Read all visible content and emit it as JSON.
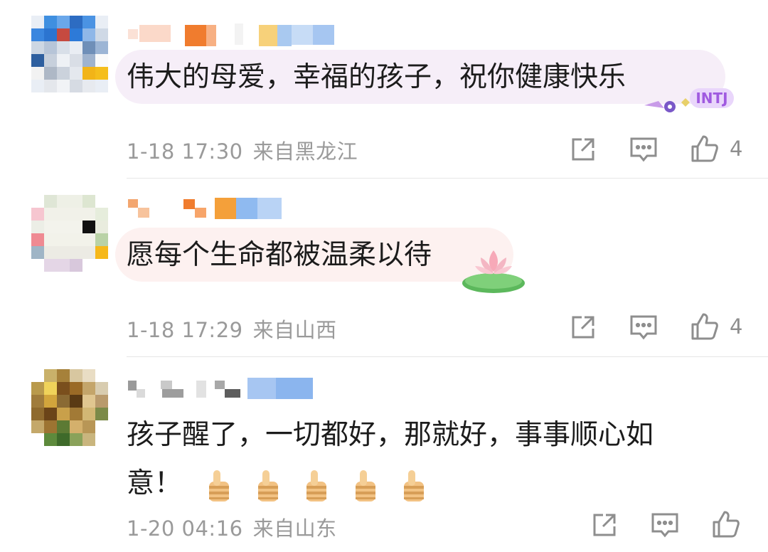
{
  "comments": [
    {
      "text": "伟大的母爱，幸福的孩子，祝你健康快乐",
      "date": "1-18 17:30",
      "location": "来自黑龙江",
      "like_count": "4",
      "badge": "INTJ"
    },
    {
      "text": "愿每个生命都被温柔以待",
      "date": "1-18 17:29",
      "location": "来自山西",
      "like_count": "4"
    },
    {
      "text_line1": "孩子醒了，一切都好，那就好，事事顺心如",
      "text_line2": "意！",
      "date": "1-20 04:16",
      "location": "来自山东",
      "like_count": ""
    }
  ],
  "icons": {
    "share": "share-icon",
    "reply": "comment-icon",
    "like": "thumbs-up-icon",
    "lotus": "lotus-icon",
    "thumbs_emoji": "thumbs-up-emoji"
  },
  "colors": {
    "bubble_purple": "#f6eef8",
    "bubble_pink": "#fdf1f0",
    "meta_gray": "#9a9a9a",
    "badge_purple": "#b06ee0"
  }
}
